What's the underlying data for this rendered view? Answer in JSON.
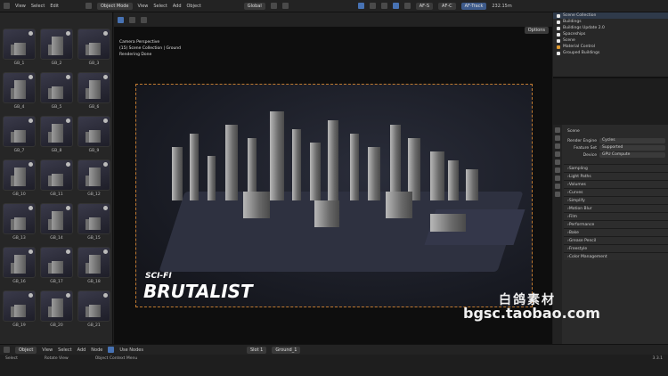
{
  "topbar": {
    "left_menu": [
      "View",
      "Select",
      "Edit"
    ],
    "mode": "Object Mode",
    "menus": [
      "View",
      "Select",
      "Add",
      "Object"
    ],
    "orientation": "Global",
    "render_slot": "AF-S",
    "af": "AF-C",
    "af_track": "AF-Track",
    "value": "232.15m"
  },
  "browser": {
    "items": [
      "GB_1",
      "GB_2",
      "GB_3",
      "GB_4",
      "GB_5",
      "GB_6",
      "GB_7",
      "GB_8",
      "GB_9",
      "GB_10",
      "GB_11",
      "GB_12",
      "GB_13",
      "GB_14",
      "GB_15",
      "GB_16",
      "GB_17",
      "GB_18",
      "GB_19",
      "GB_20",
      "GB_21"
    ]
  },
  "viewport": {
    "info_line1": "Camera Perspective",
    "info_line2": "(15) Scene Collection | Ground",
    "info_line3": "Rendering Done",
    "options": "Options",
    "logo_small": "SCI-FI",
    "logo_big": "BRUTALIST"
  },
  "outliner": {
    "rows": [
      "Scene Collection",
      "Buildings",
      "Buildings Update 2.0",
      "Spaceships",
      "Scene",
      "Material Control",
      "Grouped Buildings"
    ]
  },
  "properties": {
    "scene_label": "Scene",
    "render_engine_key": "Render Engine",
    "render_engine_val": "Cycles",
    "feature_set_key": "Feature Set",
    "feature_set_val": "Supported",
    "device_key": "Device",
    "device_val": "GPU Compute",
    "panels": [
      "Sampling",
      "Light Paths",
      "Volumes",
      "Curves",
      "Simplify",
      "Motion Blur",
      "Film",
      "Performance",
      "Bake",
      "Grease Pencil",
      "Freestyle",
      "Color Management"
    ]
  },
  "bottombar": {
    "mode": "Object",
    "menus": [
      "View",
      "Select",
      "Add",
      "Node"
    ],
    "use_nodes": "Use Nodes",
    "slot": "Slot 1",
    "material": "Ground_1"
  },
  "statusbar": {
    "items": [
      "Select",
      "Rotate View",
      "Object Context Menu"
    ],
    "version": "3.3.1"
  },
  "watermark": {
    "cn": "白鸽素材",
    "url": "bgsc.taobao.com"
  }
}
